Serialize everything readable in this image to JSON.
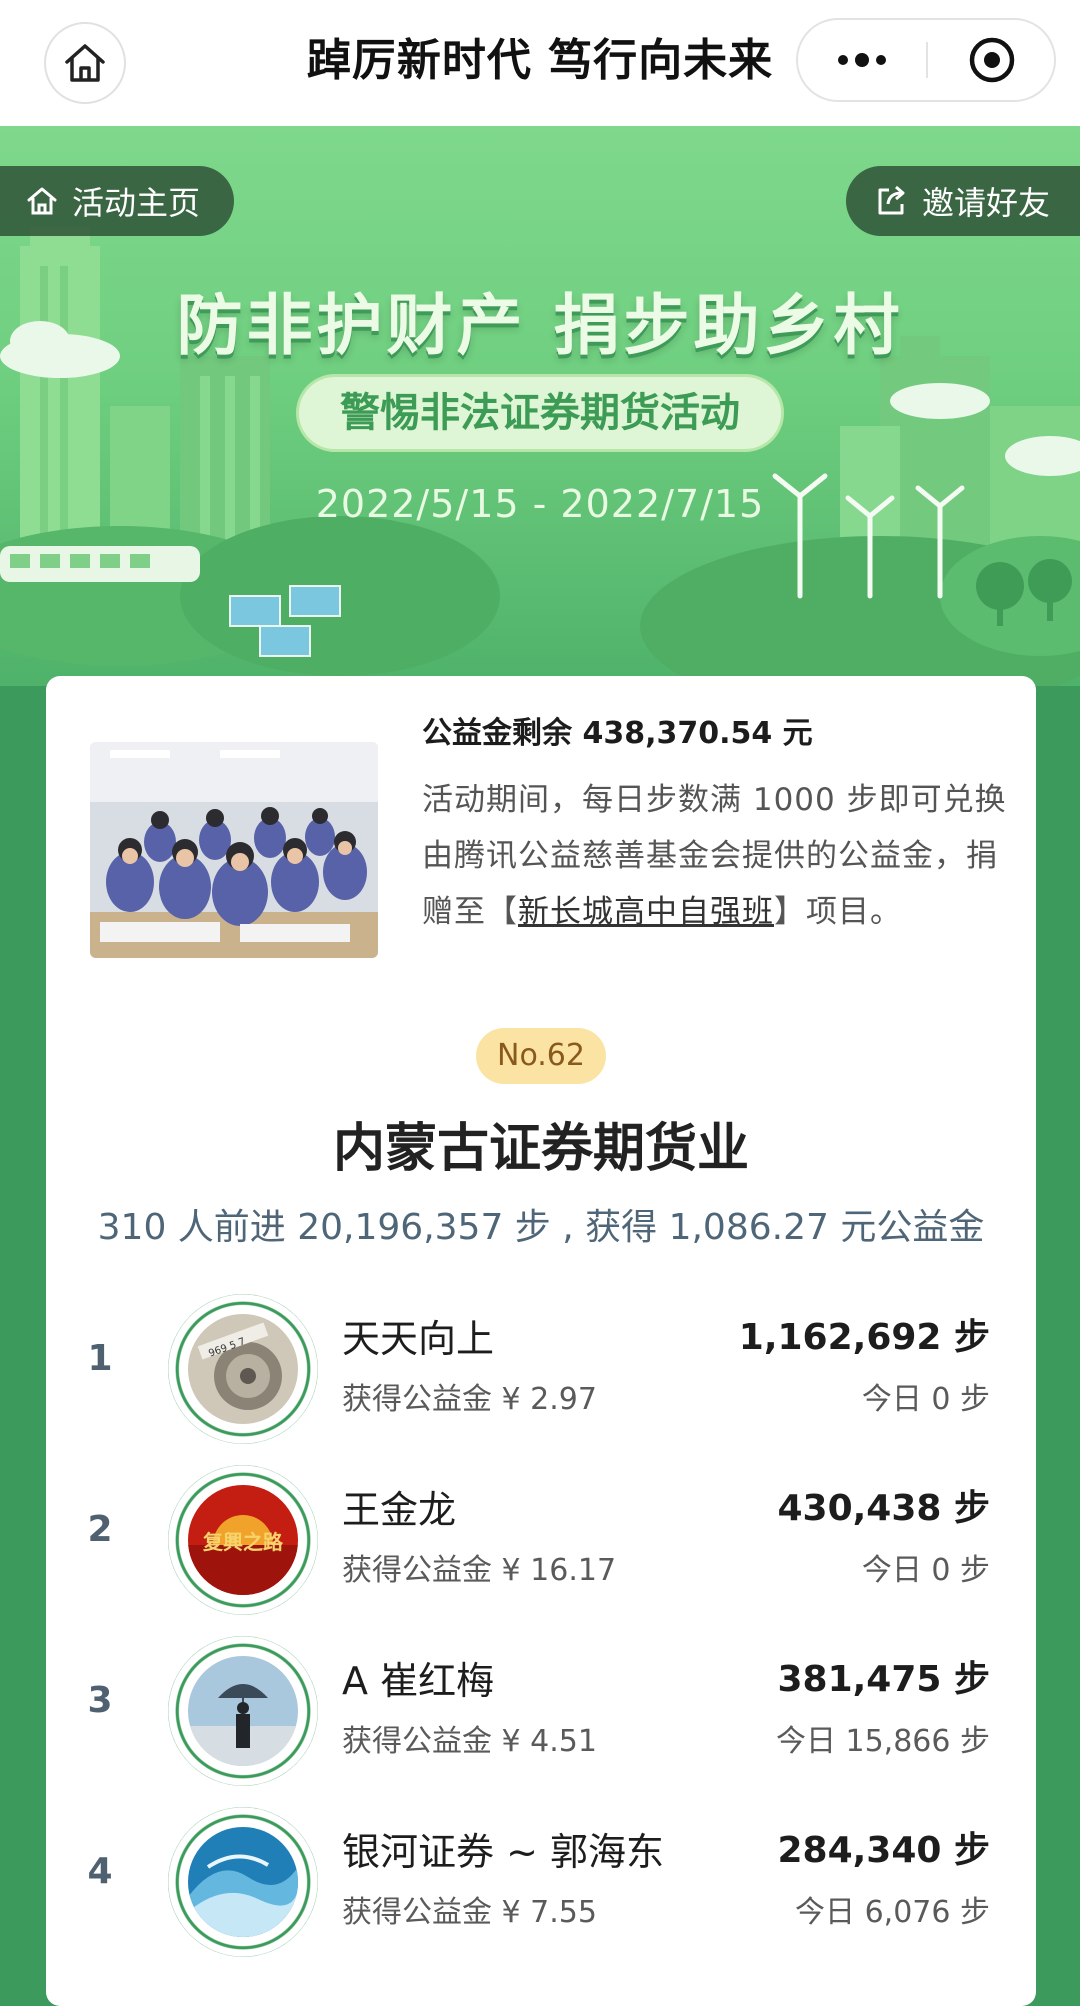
{
  "nav": {
    "title": "踔厉新时代 笃行向未来"
  },
  "banner": {
    "home_label": "活动主页",
    "invite_label": "邀请好友",
    "title": "防非护财产 捐步助乡村",
    "subtitle": "警惕非法证券期货活动",
    "date_range": "2022/5/15 - 2022/7/15"
  },
  "project": {
    "fund_title": "公益金剩余 438,370.54 元",
    "desc_before": "活动期间，每日步数满 1000 步即可兑换由腾讯公益慈善基金会提供的公益金，捐赠至【",
    "desc_link": "新长城高中自强班",
    "desc_after": "】项目。"
  },
  "team": {
    "rank": "No.62",
    "name": "内蒙古证券期货业",
    "stats": "310 人前进 20,196,357 步 , 获得 1,086.27 元公益金"
  },
  "members": [
    {
      "rank": "1",
      "name": "天天向上",
      "fund": "获得公益金 ¥ 2.97",
      "steps": "1,162,692 步",
      "today": "今日 0 步",
      "avatar_icon": "gear-icon"
    },
    {
      "rank": "2",
      "name": "王金龙",
      "fund": "获得公益金 ¥ 16.17",
      "steps": "430,438 步",
      "today": "今日 0 步",
      "avatar_icon": "sunrise-icon",
      "avatar_text": "复興之路"
    },
    {
      "rank": "3",
      "name": "A 崔红梅",
      "fund": "获得公益金 ¥ 4.51",
      "steps": "381,475 步",
      "today": "今日 15,866 步",
      "avatar_icon": "umbrella-person-icon"
    },
    {
      "rank": "4",
      "name": "银河证券 ~ 郭海东",
      "fund": "获得公益金 ¥ 7.55",
      "steps": "284,340 步",
      "today": "今日 6,076 步",
      "avatar_icon": "wave-icon"
    }
  ],
  "colors": {
    "brand_green": "#3c9a5c",
    "badge_bg": "#fbe3a3"
  }
}
